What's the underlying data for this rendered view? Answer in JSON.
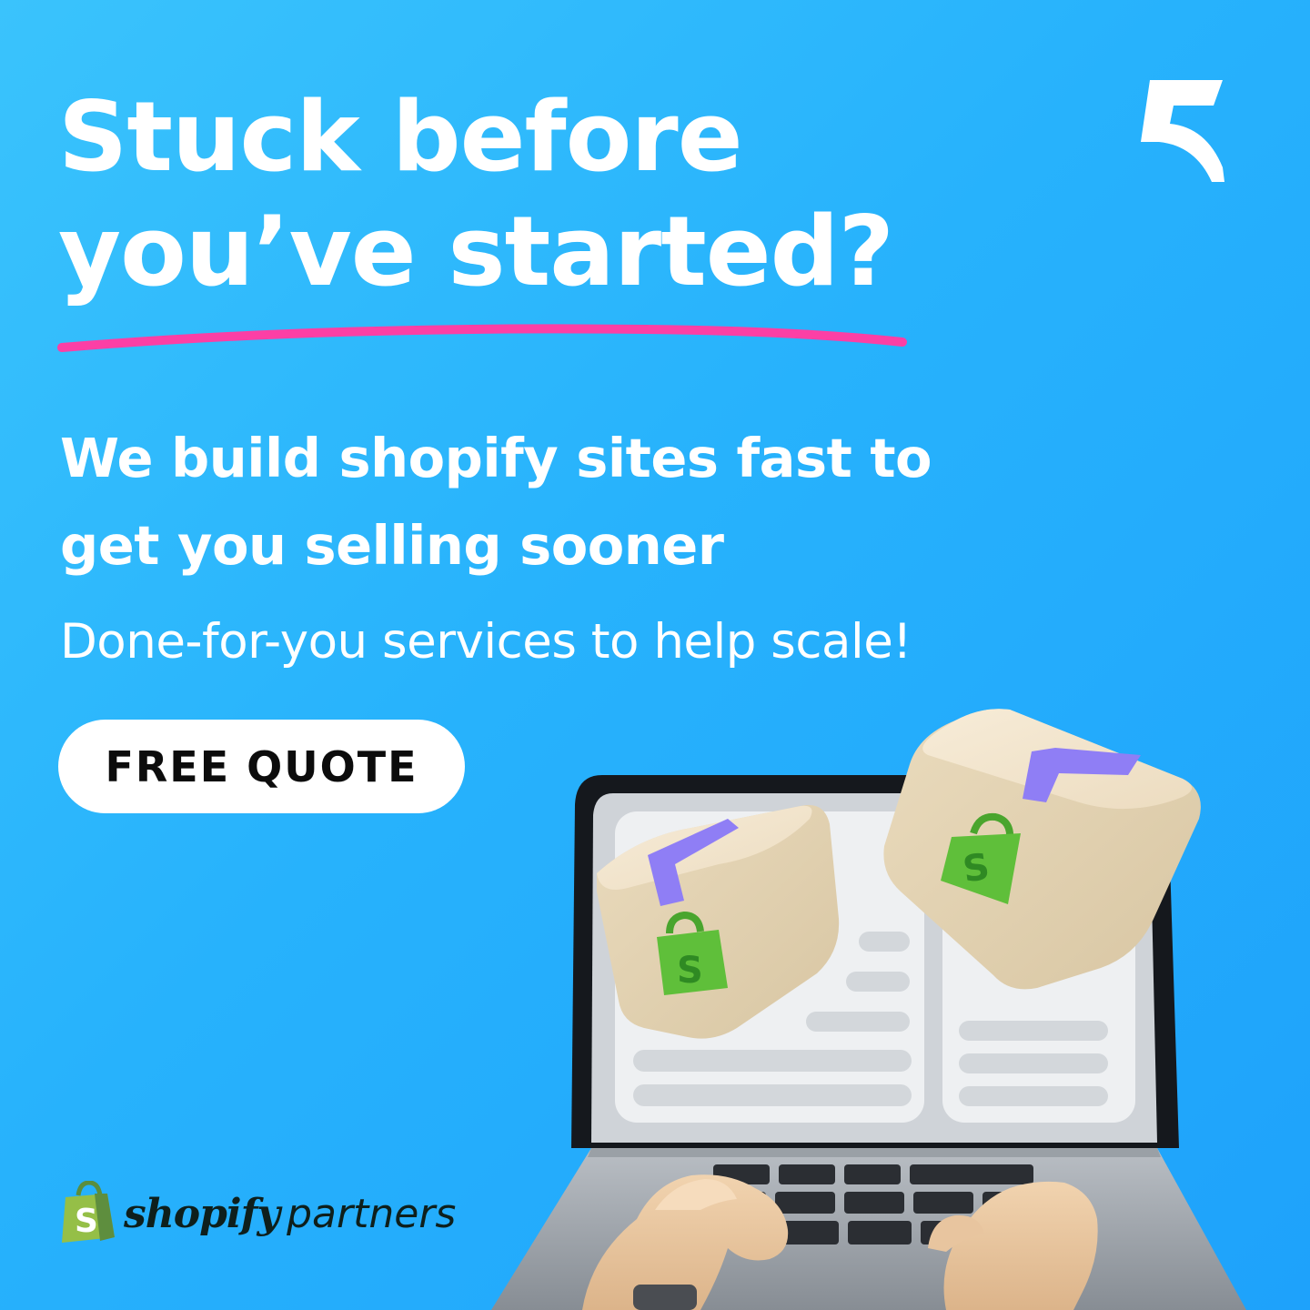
{
  "headline": {
    "line1": "Stuck before",
    "line2": "you’ve started?"
  },
  "subheadline": {
    "line1": "We build shopify sites fast to",
    "line2": "get you selling sooner"
  },
  "tagline": "Done-for-you services to help scale!",
  "cta": {
    "label": "FREE QUOTE"
  },
  "partner_badge": {
    "word1": "shopify",
    "word2": "partners"
  },
  "icons": {
    "brand_logo": "brand-logo-icon",
    "partner_bag": "shopify-bag-icon",
    "illustration": "laptop-with-shopify-boxes-illustration"
  },
  "colors": {
    "background_start": "#3ac3fc",
    "background_end": "#1ea2fb",
    "underline": "#fc3fa5",
    "cta_background": "#ffffff",
    "cta_text": "#0c0c0c",
    "shopify_green": "#5fbf3a",
    "box_ribbon": "#8f7ef5"
  }
}
